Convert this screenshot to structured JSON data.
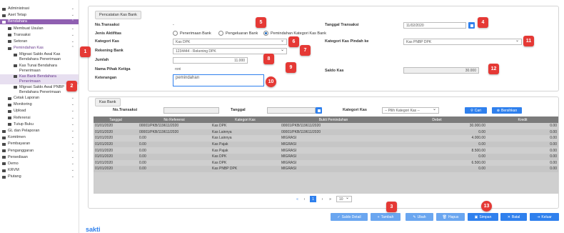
{
  "sidebar": {
    "items": [
      {
        "label": "Administrasi",
        "chev": "⌄",
        "level": 0
      },
      {
        "label": "Aset Tetap",
        "chev": "⌄",
        "level": 0
      },
      {
        "label": "Bendahara",
        "chev": "⌃",
        "level": 0,
        "state": "active"
      },
      {
        "label": "Membuat Usulan",
        "chev": "⌄",
        "level": 1
      },
      {
        "label": "Transaksi",
        "chev": "⌄",
        "level": 1
      },
      {
        "label": "Setoran",
        "chev": "⌄",
        "level": 1
      },
      {
        "label": "Pemindahan Kas",
        "chev": "⌃",
        "level": 1,
        "state": "hl"
      },
      {
        "label": "Migrasi Saldo Awal Kas Bendahara Penerimaan",
        "chev": "",
        "level": 2
      },
      {
        "label": "Kas Tunai Bendahara Penerimaan",
        "chev": "",
        "level": 2
      },
      {
        "label": "Kas Bank Bendahara Penerimaan",
        "chev": "",
        "level": 2,
        "state": "sub-active"
      },
      {
        "label": "Migrasi Saldo Awal PNBP Bendahara Penerimaan",
        "chev": "",
        "level": 2
      },
      {
        "label": "Cetak Laporan",
        "chev": "⌄",
        "level": 1
      },
      {
        "label": "Monitoring",
        "chev": "⌄",
        "level": 1
      },
      {
        "label": "Upload",
        "chev": "⌄",
        "level": 1
      },
      {
        "label": "Referensi",
        "chev": "⌄",
        "level": 1
      },
      {
        "label": "Tutup Buku",
        "chev": "⌄",
        "level": 1
      },
      {
        "label": "GL dan Pelaporan",
        "chev": "⌄",
        "level": 0
      },
      {
        "label": "Komitmen",
        "chev": "⌄",
        "level": 0
      },
      {
        "label": "Pembayaran",
        "chev": "⌄",
        "level": 0
      },
      {
        "label": "Penganggaran",
        "chev": "⌄",
        "level": 0
      },
      {
        "label": "Persediaan",
        "chev": "⌄",
        "level": 0
      },
      {
        "label": "Demo",
        "chev": "⌄",
        "level": 0
      },
      {
        "label": "KRVM",
        "chev": "⌄",
        "level": 0
      },
      {
        "label": "Piutang",
        "chev": "⌄",
        "level": 0
      }
    ]
  },
  "form": {
    "panel_title": "Pencatatan Kas Bank",
    "no_transaksi_label": "No.Transaksi",
    "no_transaksi_value": "-",
    "jenis_label": "Jenis Aktifitas",
    "radio_penerimaan": "Penerimaan Bank",
    "radio_pengeluaran": "Pengeluaran Bank",
    "radio_pemindahan": "Pemindahan Kategori Kas Bank",
    "kategori_label": "Kategori Kas",
    "kategori_value": "Kas DPK",
    "rekening_label": "Rekening Bank",
    "rekening_value": "1234444 - Rekening DPK",
    "jumlah_label": "Jumlah",
    "jumlah_value": "11.000",
    "pihak_label": "Nama Pihak Ketiga",
    "pihak_value": "roni",
    "keterangan_label": "Keterangan",
    "keterangan_value": "pemindahan",
    "tanggal_label": "Tanggal Transaksi",
    "tanggal_value": "11/02/2020",
    "kategori_pindah_label": "Kategori Kas Pindah ke",
    "kategori_pindah_value": "Kas PNBP DPK",
    "saldo_label": "Saldo Kas",
    "saldo_value": "30.000"
  },
  "kasbank": {
    "panel_title": "Kas Bank",
    "no_transaksi_label": "No.Transaksi",
    "tanggal_label": "Tanggal",
    "kategori_label": "Kategori Kas",
    "kategori_placeholder": "-- Pilih Kategori Kas --",
    "cari_label": "Cari",
    "bersihkan_label": "Bersihkan"
  },
  "grid": {
    "columns": [
      "Tanggal",
      "No Referensi",
      "Kategori Kas",
      "Bukti Pemindahan",
      "Debet",
      "Kredit"
    ],
    "rows": [
      [
        "01/01/2020",
        "00001/PKB/119611/2020",
        "Kas DPK",
        "00001/PKB/119611/2020",
        "30.000.00",
        "0.00"
      ],
      [
        "01/01/2020",
        "00001/PKB/119611/2020",
        "Kas Lainnya",
        "00001/PKB/119611/2020",
        "0.00",
        "0.00"
      ],
      [
        "01/01/2020",
        "0.00",
        "Kas Lainnya",
        "MIGRASI",
        "4.000.00",
        "0.00"
      ],
      [
        "01/01/2020",
        "0.00",
        "Kas Pajak",
        "MIGRASI",
        "0.00",
        "0.00"
      ],
      [
        "01/01/2020",
        "0.00",
        "Kas Pajak",
        "MIGRASI",
        "8.500.00",
        "0.00"
      ],
      [
        "01/01/2020",
        "0.00",
        "Kas DPK",
        "MIGRASI",
        "0.00",
        "0.00"
      ],
      [
        "01/01/2020",
        "0.00",
        "Kas DPK",
        "MIGRASI",
        "6.500.00",
        "0.00"
      ],
      [
        "01/01/2020",
        "0.00",
        "Kas PNBP DPK",
        "MIGRASI",
        "0.00",
        "0.00"
      ],
      [
        "01/01/2020",
        "0.00",
        "Kas PNBP DPK",
        "MIGRASI",
        "3.000.00",
        "0.00"
      ]
    ],
    "pagination": {
      "first": "«",
      "prev": "‹",
      "current": "1",
      "next": "›",
      "last": "»",
      "per_page": "10"
    }
  },
  "toolbar": {
    "saldo_detail": "Saldo Detail",
    "tambah": "Tambah",
    "ubah": "Ubah",
    "hapus": "Hapus",
    "simpan": "Simpan",
    "batal": "Batal",
    "keluar": "Keluar"
  },
  "markers": [
    "1",
    "2",
    "3",
    "4",
    "5",
    "6",
    "7",
    "8",
    "9",
    "10",
    "11",
    "12",
    "13"
  ],
  "footer": {
    "logo": "sakti"
  },
  "colors": {
    "accent": "#2f80ed",
    "sidebar_active": "#8f5fb1",
    "marker": "#e53935"
  }
}
